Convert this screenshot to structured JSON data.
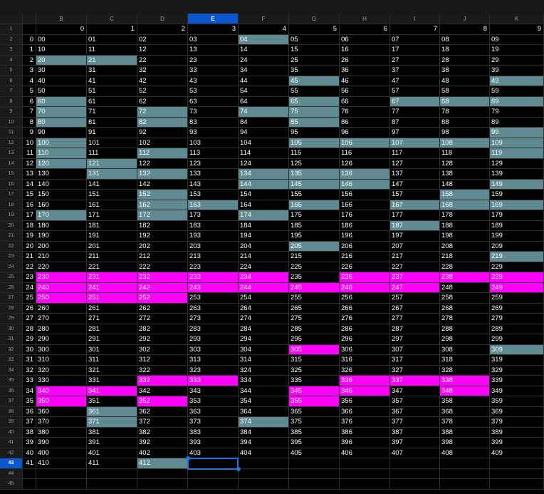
{
  "sheet": {
    "column_headers": [
      "B",
      "C",
      "D",
      "E",
      "F",
      "G",
      "H",
      "I",
      "J",
      "K"
    ],
    "selected_column": "E",
    "selected_row": 43,
    "row_count": 45,
    "header_row_values": [
      "0",
      "1",
      "2",
      "3",
      "4",
      "5",
      "6",
      "7",
      "8",
      "9"
    ],
    "teal_cells": [
      "04",
      "20",
      "21",
      "45",
      "49",
      "60",
      "65",
      "67",
      "68",
      "69",
      "70",
      "72",
      "74",
      "75",
      "80",
      "82",
      "85",
      "99",
      "100",
      "105",
      "106",
      "107",
      "108",
      "109",
      "110",
      "112",
      "119",
      "120",
      "121",
      "131",
      "132",
      "134",
      "135",
      "136",
      "144",
      "145",
      "146",
      "149",
      "152",
      "158",
      "162",
      "163",
      "165",
      "167",
      "168",
      "169",
      "170",
      "172",
      "174",
      "187",
      "205",
      "219",
      "309",
      "361",
      "371",
      "374",
      "412"
    ],
    "magenta_cells": [
      "230",
      "231",
      "232",
      "233",
      "234",
      "236",
      "237",
      "238",
      "239",
      "240",
      "241",
      "242",
      "243",
      "244",
      "245",
      "246",
      "247",
      "249",
      "250",
      "251",
      "252",
      "305",
      "332",
      "333",
      "336",
      "337",
      "338",
      "340",
      "341",
      "345",
      "346",
      "348",
      "350",
      "352",
      "355"
    ],
    "colors": {
      "teal": "#5f8a91",
      "magenta": "#ff00ff",
      "selection": "#1a73e8",
      "header_selected": "#0b57d0"
    }
  }
}
